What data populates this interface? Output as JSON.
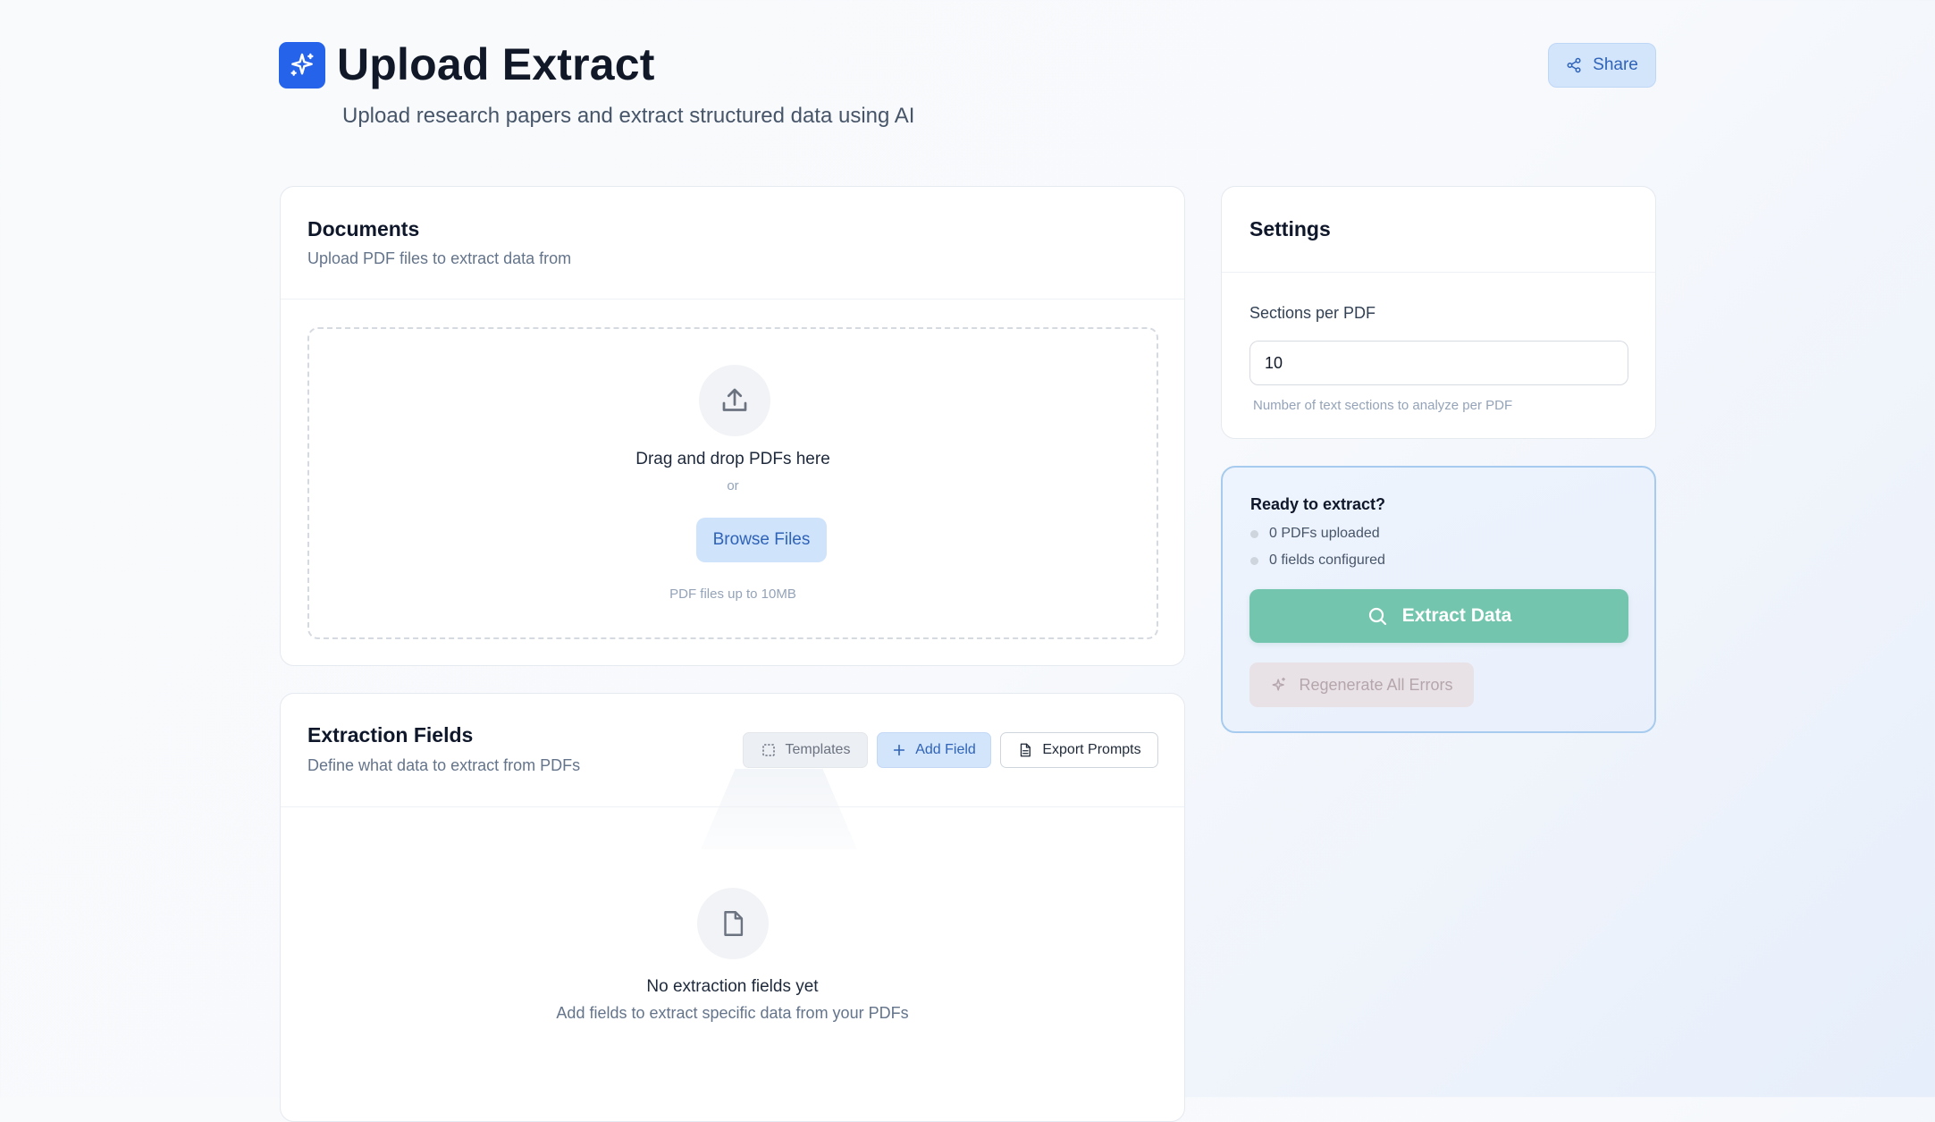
{
  "header": {
    "title": "Upload Extract",
    "subtitle": "Upload research papers and extract structured data using AI",
    "share_label": "Share",
    "logo_icon": "sparkles-icon",
    "accent_color": "#2563eb"
  },
  "documents": {
    "title": "Documents",
    "description": "Upload PDF files to extract data from",
    "dropzone": {
      "icon": "upload-icon",
      "primary_text": "Drag and drop PDFs here",
      "or_text": "or",
      "browse_label": "Browse Files",
      "hint": "PDF files up to 10MB"
    }
  },
  "extraction_fields": {
    "title": "Extraction Fields",
    "description": "Define what data to extract from PDFs",
    "toolbar": {
      "templates_label": "Templates",
      "add_field_label": "Add Field",
      "export_prompts_label": "Export Prompts"
    },
    "empty_state": {
      "icon": "file-icon",
      "title": "No extraction fields yet",
      "subtitle": "Add fields to extract specific data from your PDFs"
    }
  },
  "settings": {
    "title": "Settings",
    "sections_label": "Sections per PDF",
    "sections_value": "10",
    "sections_help": "Number of text sections to analyze per PDF"
  },
  "ready": {
    "title": "Ready to extract?",
    "pdfs_status": "0 PDFs uploaded",
    "fields_status": "0 fields configured",
    "extract_label": "Extract Data",
    "regenerate_label": "Regenerate All Errors",
    "extract_color": "#73c5ad"
  }
}
